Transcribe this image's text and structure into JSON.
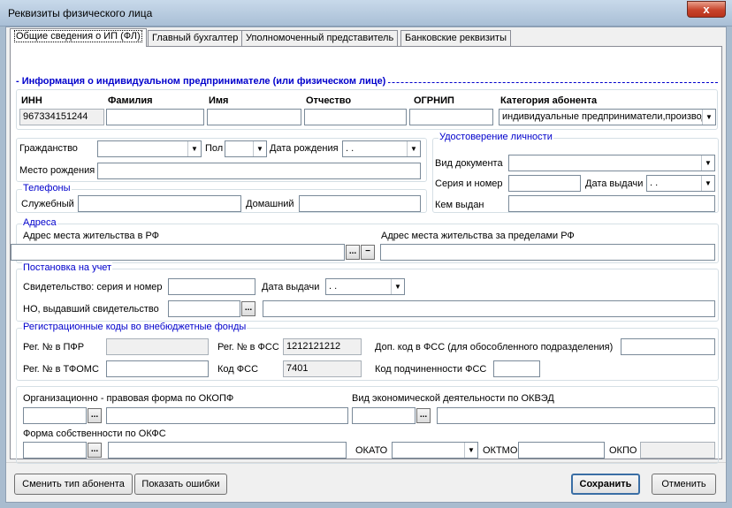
{
  "window": {
    "title": "Реквизиты физического лица",
    "close_symbol": "x"
  },
  "tabs": [
    {
      "label": "Общие сведения о ИП (ФЛ)"
    },
    {
      "label": "Главный бухгалтер"
    },
    {
      "label": "Уполномоченный представитель"
    },
    {
      "label": "Банковские реквизиты"
    }
  ],
  "info": {
    "header": "- Информация о индивидуальном предпринимателе (или физическом лице)",
    "inn_label": "ИНН",
    "inn_value": "967334151244",
    "surname_label": "Фамилия",
    "name_label": "Имя",
    "patronymic_label": "Отчество",
    "ogrnip_label": "ОГРНИП",
    "category_label": "Категория абонента",
    "category_value": "индивидуальные предприниматели,производители"
  },
  "personal": {
    "citizenship_label": "Гражданство",
    "sex_label": "Пол",
    "birthdate_label": "Дата рождения",
    "birthdate_value": ". .",
    "birthplace_label": "Место рождения"
  },
  "identity": {
    "title": "Удостоверение личности",
    "doc_type_label": "Вид документа",
    "series_label": "Серия и номер",
    "issue_date_label": "Дата выдачи",
    "issue_date_value": ". .",
    "issued_by_label": "Кем выдан"
  },
  "phones": {
    "title": "Телефоны",
    "work_label": "Служебный",
    "home_label": "Домашний"
  },
  "addresses": {
    "title": "Адреса",
    "rf_label": "Адрес места жительства в РФ",
    "abroad_label": "Адрес места жительства за пределами РФ",
    "ellipsis": "...",
    "minus": "−"
  },
  "registration": {
    "title": "Постановка на учет",
    "cert_label": "Свидетельство: серия и номер",
    "issue_date_label": "Дата выдачи",
    "issue_date_value": ". .",
    "tax_office_label": "НО, выдавший свидетельство",
    "ellipsis": "..."
  },
  "funds": {
    "title": "Регистрационные коды во внебюджетные фонды",
    "pfr_label": "Рег. № в ПФР",
    "fss_label": "Рег. № в ФСС",
    "fss_value": "1212121212",
    "dop_fss_label": "Доп. код в ФСС (для обособленного подразделения)",
    "tfoms_label": "Рег. № в ТФОМС",
    "fss_code_label": "Код ФСС",
    "fss_code_value": "7401",
    "sub_fss_label": "Код подчиненности ФСС"
  },
  "classifiers": {
    "okopf_label": "Организационно - правовая форма по ОКОПФ",
    "okved_label": "Вид экономической деятельности по ОКВЭД",
    "okfs_label": "Форма собственности по ОКФС",
    "okato_label": "ОКАТО",
    "oktmo_label": "ОКТМО",
    "okpo_label": "ОКПО",
    "ellipsis": "..."
  },
  "footer": {
    "change_type": "Сменить тип абонента",
    "show_errors": "Показать ошибки",
    "save": "Сохранить",
    "cancel": "Отменить"
  },
  "icons": {
    "dropdown": "▼"
  }
}
